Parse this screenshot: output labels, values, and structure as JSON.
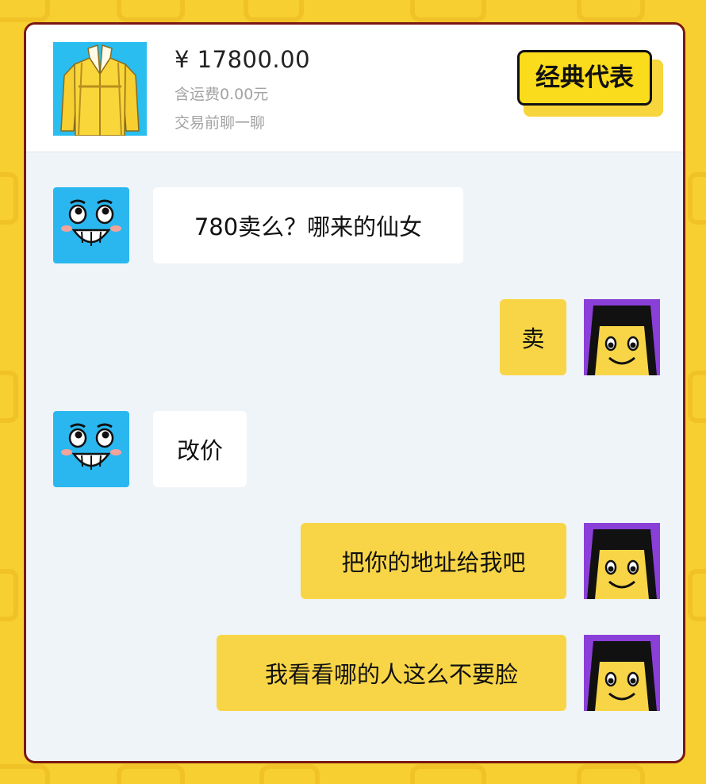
{
  "product": {
    "price": "¥ 17800.00",
    "shipping": "含运费0.00元",
    "chat_note": "交易前聊一聊",
    "tag": "经典代表"
  },
  "messages": [
    {
      "from": "buyer",
      "text": "780卖么？哪来的仙女"
    },
    {
      "from": "seller",
      "text": "卖"
    },
    {
      "from": "buyer",
      "text": "改价"
    },
    {
      "from": "seller",
      "text": "把你的地址给我吧"
    },
    {
      "from": "seller",
      "text": "我看看哪的人这么不要脸"
    }
  ],
  "colors": {
    "background": "#f7cf31",
    "card_border": "#7a1712",
    "chat_background": "#eff4f8",
    "incoming_bubble": "#ffffff",
    "outgoing_bubble": "#f8d547",
    "buyer_avatar": "#2ab7ef",
    "seller_avatar": "#f8d547"
  }
}
